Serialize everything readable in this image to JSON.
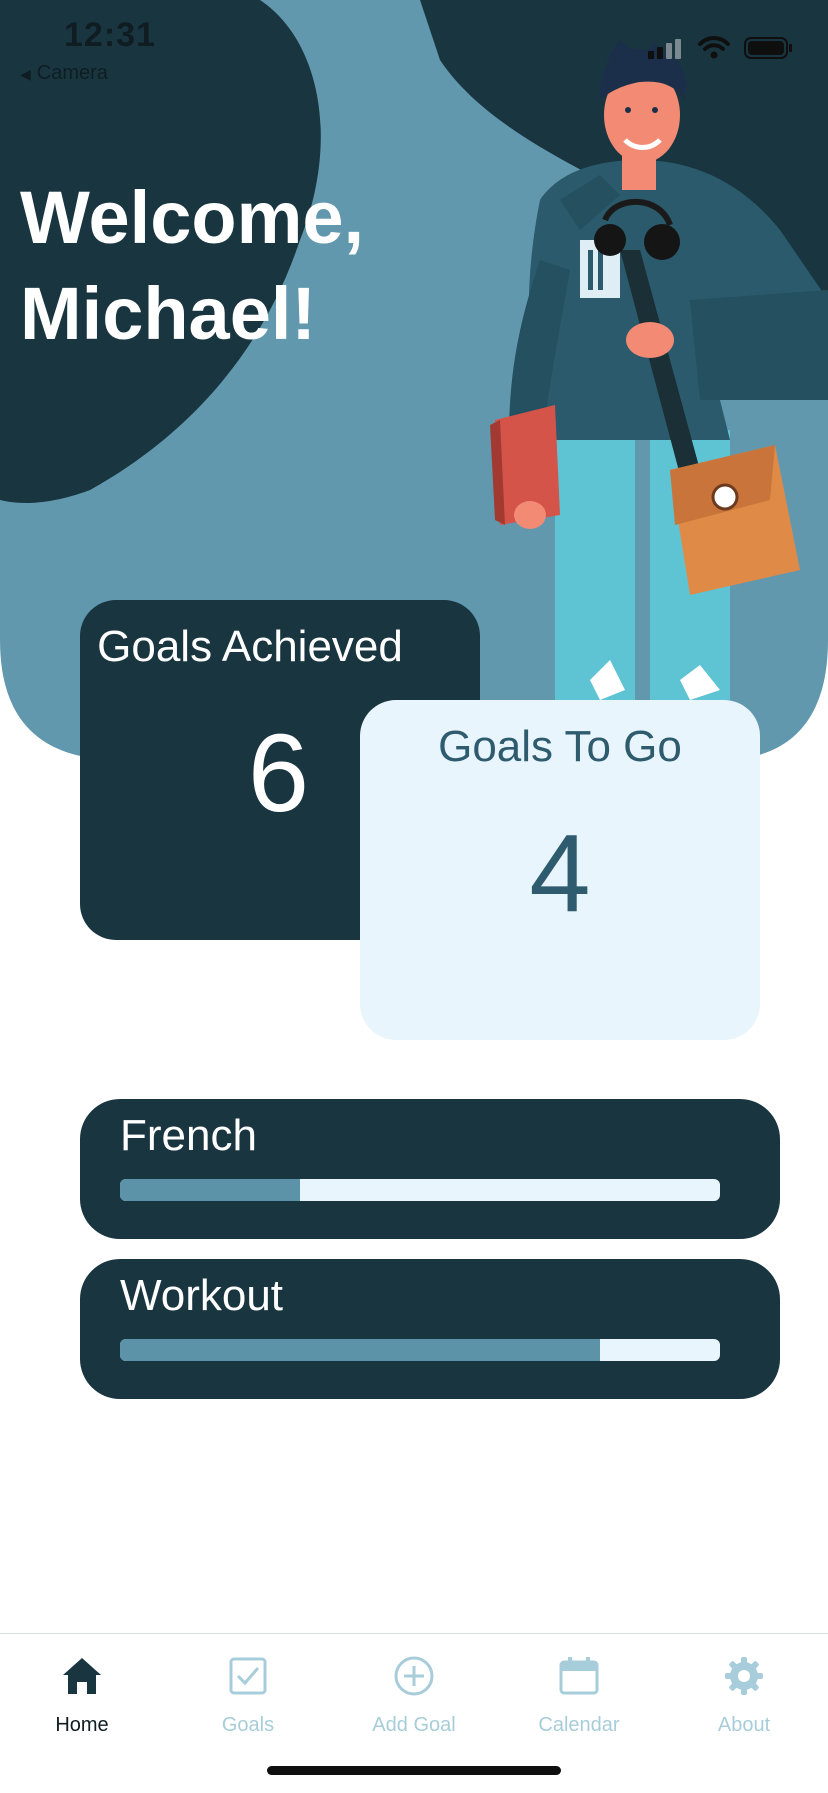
{
  "status_bar": {
    "time": "12:31",
    "back_label": "Camera"
  },
  "greeting": {
    "line1": "Welcome,",
    "line2": "Michael!"
  },
  "stats": {
    "achieved": {
      "label": "Goals Achieved",
      "value": "6"
    },
    "to_go": {
      "label": "Goals To Go",
      "value": "4"
    }
  },
  "goals": [
    {
      "name": "French",
      "progress": 0.3
    },
    {
      "name": "Workout",
      "progress": 0.8
    }
  ],
  "tabs": [
    {
      "label": "Home",
      "icon": "home-icon",
      "active": true
    },
    {
      "label": "Goals",
      "icon": "checkbox-icon",
      "active": false
    },
    {
      "label": "Add Goal",
      "icon": "plus-circle-icon",
      "active": false
    },
    {
      "label": "Calendar",
      "icon": "calendar-icon",
      "active": false
    },
    {
      "label": "About",
      "icon": "gear-icon",
      "active": false
    }
  ],
  "colors": {
    "dark": "#193640",
    "light": "#e8f5fc",
    "accent": "#5d93a8",
    "inactive_tab": "#a8cdda"
  }
}
